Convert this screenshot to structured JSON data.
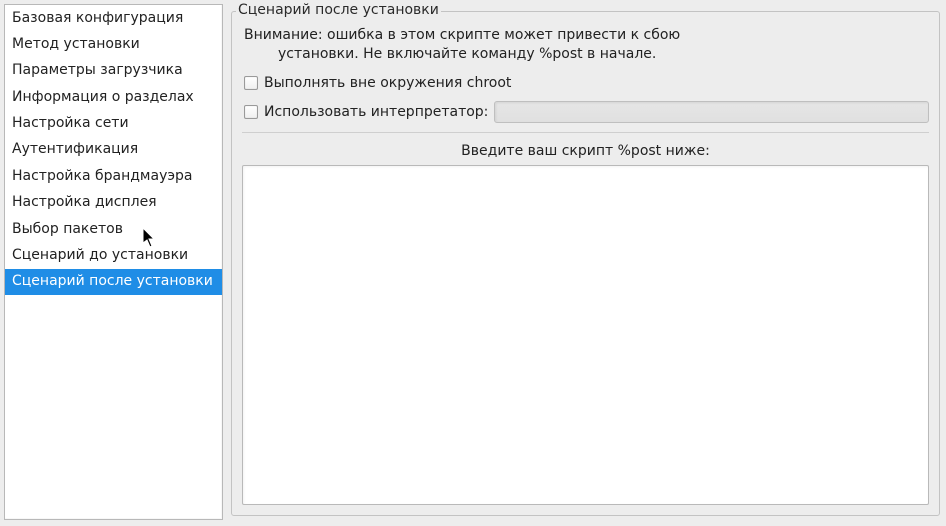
{
  "sidebar": {
    "items": [
      {
        "label": "Базовая конфигурация",
        "selected": false
      },
      {
        "label": "Метод установки",
        "selected": false
      },
      {
        "label": "Параметры загрузчика",
        "selected": false
      },
      {
        "label": "Информация о разделах",
        "selected": false
      },
      {
        "label": "Настройка сети",
        "selected": false
      },
      {
        "label": "Аутентификация",
        "selected": false
      },
      {
        "label": "Настройка брандмауэра",
        "selected": false
      },
      {
        "label": "Настройка дисплея",
        "selected": false
      },
      {
        "label": "Выбор пакетов",
        "selected": false
      },
      {
        "label": "Сценарий до установки",
        "selected": false
      },
      {
        "label": "Сценарий после установки",
        "selected": true
      }
    ]
  },
  "panel": {
    "title": "Сценарий после установки",
    "warning_line1": "Внимание: ошибка в этом скрипте может привести к сбою",
    "warning_line2": "установки. Не включайте команду %post в начале.",
    "option_run_outside_chroot": "Выполнять вне окружения chroot",
    "option_use_interpreter": "Использовать интерпретатор:",
    "interpreter_value": "",
    "script_label": "Введите ваш скрипт %post ниже:",
    "script_value": ""
  },
  "state": {
    "run_outside_chroot_checked": false,
    "use_interpreter_checked": false,
    "interpreter_enabled": false
  }
}
